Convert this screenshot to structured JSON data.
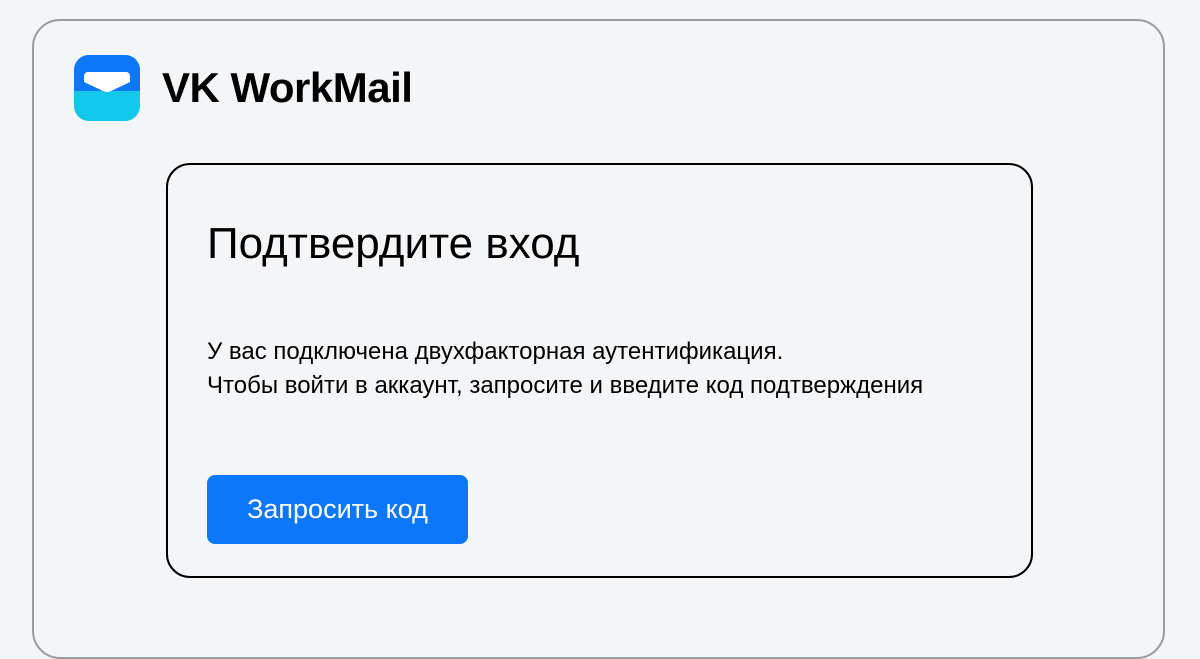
{
  "brand": {
    "name": "VK WorkMail",
    "logo_icon": "envelope-icon",
    "logo_colors": {
      "top": "#0d77f9",
      "bottom": "#13c8ea",
      "envelope": "#ffffff"
    }
  },
  "card": {
    "title": "Подтвердите вход",
    "lines": [
      "У вас подключена двухфакторная аутентификация.",
      "Чтобы войти в аккаунт, запросите и введите код подтверждения"
    ],
    "button_label": "Запросить код"
  },
  "colors": {
    "page_background": "#f4f5f7",
    "accent": "#0d77f9",
    "frame_border": "#9a9ba0"
  }
}
